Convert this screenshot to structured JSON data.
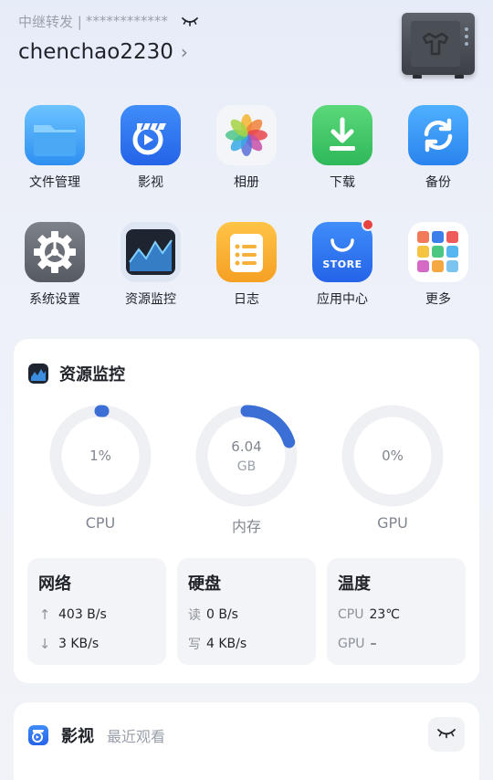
{
  "header": {
    "relay_label": "中继转发 |",
    "relay_password": "************",
    "username": "chenchao2230",
    "chevron": "›"
  },
  "apps": {
    "row1": [
      {
        "label": "文件管理",
        "icon": "folder-icon"
      },
      {
        "label": "影视",
        "icon": "video-icon"
      },
      {
        "label": "相册",
        "icon": "photos-icon"
      },
      {
        "label": "下载",
        "icon": "download-icon"
      },
      {
        "label": "备份",
        "icon": "backup-icon"
      }
    ],
    "row2": [
      {
        "label": "系统设置",
        "icon": "settings-icon"
      },
      {
        "label": "资源监控",
        "icon": "monitor-icon"
      },
      {
        "label": "日志",
        "icon": "log-icon"
      },
      {
        "label": "应用中心",
        "icon": "store-icon",
        "icon_text": "STORE",
        "badge": true
      },
      {
        "label": "更多",
        "icon": "more-icon"
      }
    ]
  },
  "resource": {
    "title": "资源监控",
    "gauges": [
      {
        "name": "CPU",
        "value": "1%",
        "unit": "",
        "fraction": 0.01,
        "color": "#3c6fd6"
      },
      {
        "name": "内存",
        "value": "6.04",
        "unit": "GB",
        "fraction": 0.2,
        "color": "#3c6fd6"
      },
      {
        "name": "GPU",
        "value": "0%",
        "unit": "",
        "fraction": 0.0,
        "color": "#3c6fd6"
      }
    ],
    "network": {
      "title": "网络",
      "up": "403 B/s",
      "down": "3 KB/s"
    },
    "disk": {
      "title": "硬盘",
      "read_label": "读",
      "read": "0 B/s",
      "write_label": "写",
      "write": "4 KB/s"
    },
    "temp": {
      "title": "温度",
      "cpu_label": "CPU",
      "cpu": "23℃",
      "gpu_label": "GPU",
      "gpu": "–"
    }
  },
  "media": {
    "title": "影视",
    "subtitle": "最近观看"
  },
  "colors": {
    "accent": "#3c6fd6",
    "ring_bg": "#eef0f4",
    "badge": "#e8433f"
  }
}
